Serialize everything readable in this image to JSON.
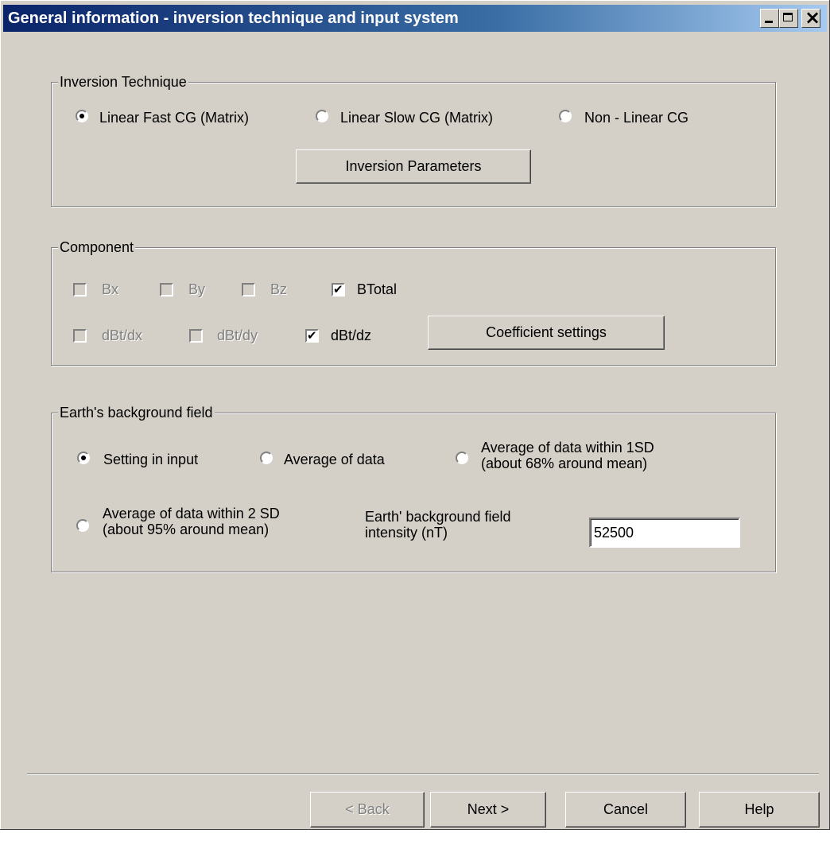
{
  "window": {
    "title": "General information - inversion technique and  input system"
  },
  "inversion": {
    "legend": "Inversion Technique",
    "options": [
      "Linear Fast CG (Matrix)",
      "Linear Slow CG (Matrix)",
      "Non - Linear CG"
    ],
    "selected": "Linear Fast CG (Matrix)",
    "params_button": "Inversion Parameters"
  },
  "component": {
    "legend": "Component",
    "bx": "Bx",
    "by": "By",
    "bz": "Bz",
    "btotal": "BTotal",
    "dbtdx": "dBt/dx",
    "dbtdy": "dBt/dy",
    "dbtdz": "dBt/dz",
    "coeff_button": "Coefficient settings"
  },
  "background": {
    "legend": "Earth's background field",
    "opt_setting": "Setting in input",
    "opt_average": "Average of data",
    "opt_1sd": "Average of data within 1SD (about 68% around mean)",
    "opt_2sd": "Average of data within 2 SD (about 95% around mean)",
    "selected": "Setting in input",
    "intensity_label": "Earth' background field intensity (nT)",
    "intensity_value": "52500"
  },
  "footer": {
    "back": "< Back",
    "next": "Next >",
    "cancel": "Cancel",
    "help": "Help"
  }
}
